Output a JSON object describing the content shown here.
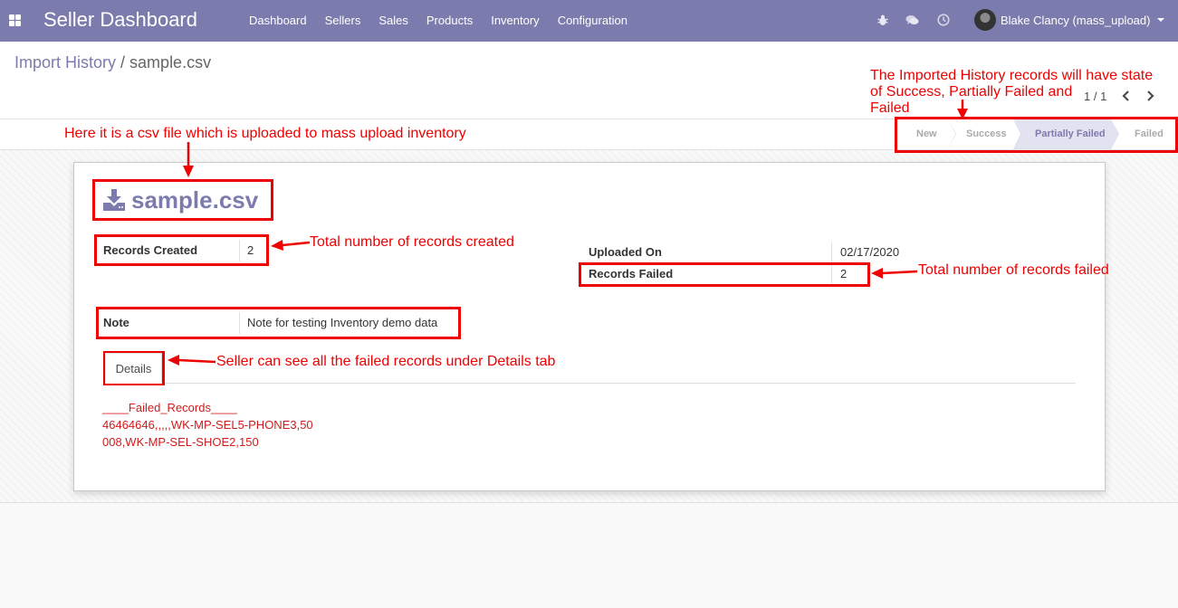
{
  "navbar": {
    "brand": "Seller Dashboard",
    "menu": [
      "Dashboard",
      "Sellers",
      "Sales",
      "Products",
      "Inventory",
      "Configuration"
    ],
    "user": "Blake Clancy (mass_upload)",
    "color": "#7c7bad"
  },
  "breadcrumb": {
    "parent": "Import History",
    "separator": "/",
    "current": "sample.csv"
  },
  "pager": {
    "value": "1 / 1"
  },
  "statusbar": {
    "stages": [
      "New",
      "Success",
      "Partially Failed",
      "Failed"
    ],
    "active": "Partially Failed"
  },
  "record": {
    "title": "sample.csv",
    "records_created_label": "Records Created",
    "records_created": "2",
    "uploaded_on_label": "Uploaded On",
    "uploaded_on": "02/17/2020",
    "records_failed_label": "Records Failed",
    "records_failed": "2",
    "note_label": "Note",
    "note": "Note for testing Inventory demo data",
    "tab_label": "Details",
    "failed_records": [
      "____Failed_Records____",
      "46464646,,,,,WK-MP-SEL5-PHONE3,50",
      "008,WK-MP-SEL-SHOE2,150"
    ]
  },
  "annotations": {
    "states_line1": "The Imported History records will have state",
    "states_line2": "of Success, Partially Failed and",
    "states_line3": "Failed",
    "csv": "Here it is a csv file which is uploaded to mass upload inventory",
    "created": "Total number of records created",
    "failed": "Total number of records failed",
    "details": "Seller can see all the failed records under Details tab",
    "color": "#ee0000"
  },
  "icons": [
    "apps-icon",
    "bug-icon",
    "chat-icon",
    "clock-icon",
    "caret-down-icon",
    "chevron-left-icon",
    "chevron-right-icon",
    "download-icon"
  ]
}
